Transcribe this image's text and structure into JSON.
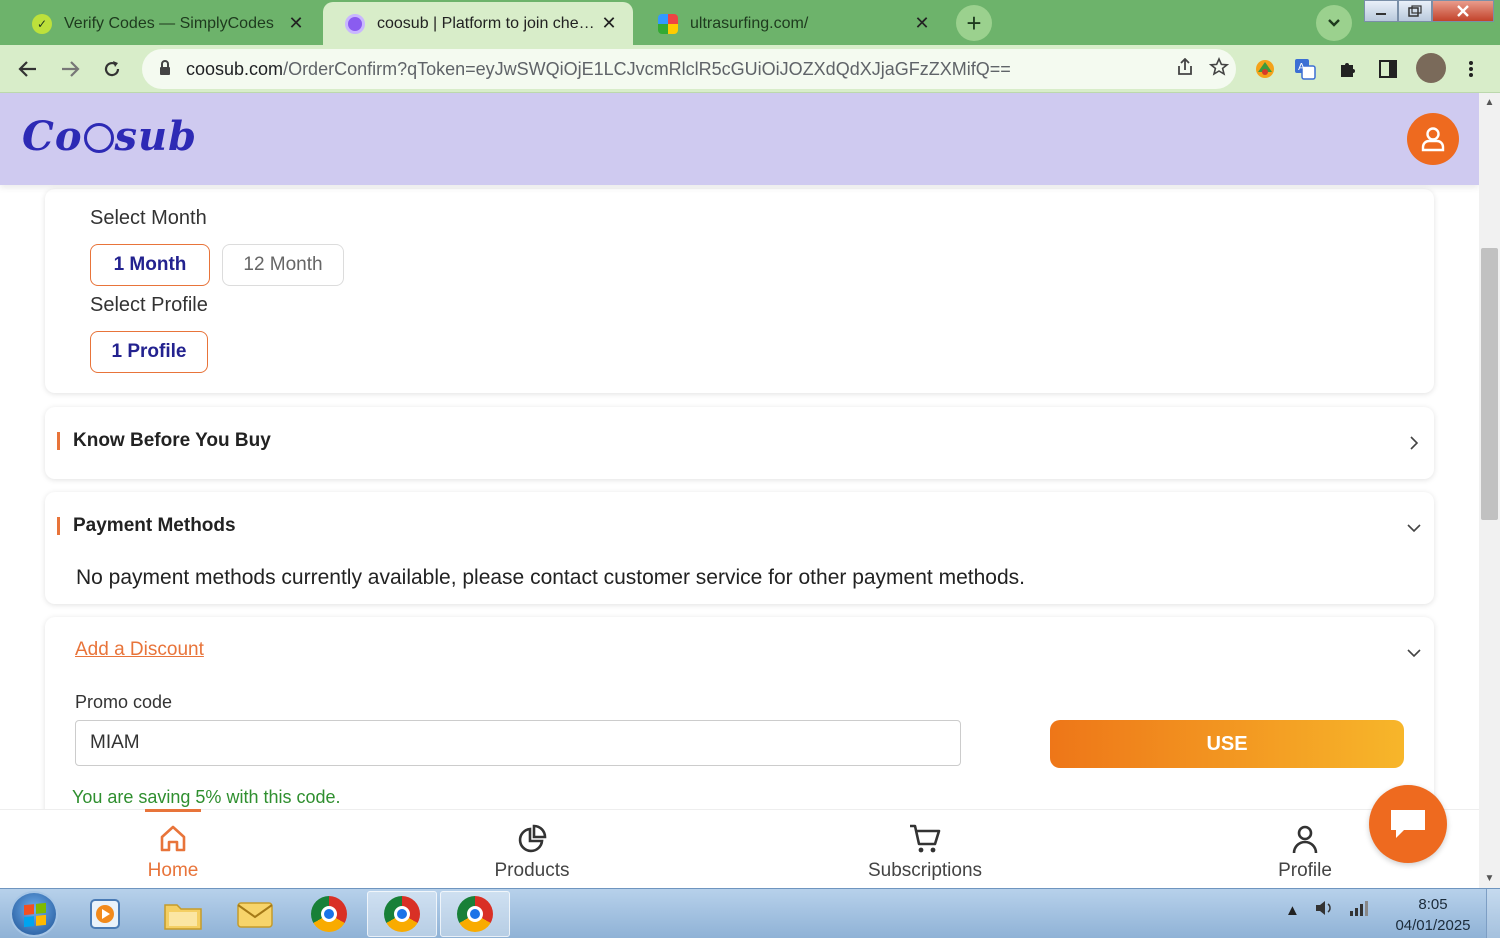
{
  "browser": {
    "tabs": [
      {
        "title": "Verify Codes — SimplyCodes",
        "close": "✕"
      },
      {
        "title": "coosub | Platform to join cheap s",
        "close": "✕"
      },
      {
        "title": "ultrasurfing.com/",
        "close": "✕"
      }
    ],
    "new_tab": "+",
    "url_host": "coosub.com",
    "url_path": "/OrderConfirm?qToken=eyJwSWQiOjE1LCJvcmRlclR5cGUiOiJOZXdQdXJjaGFzZXMifQ=="
  },
  "site": {
    "logo_left": "Co",
    "logo_right": "sub"
  },
  "order": {
    "month_label": "Select Month",
    "month_options": [
      "1 Month",
      "12 Month"
    ],
    "profile_label": "Select Profile",
    "profile_option": "1 Profile"
  },
  "sections": {
    "know_before": "Know Before You Buy",
    "payment_title": "Payment Methods",
    "payment_message": "No payment methods currently available, please contact customer service for other payment methods.",
    "discount_link": "Add a Discount",
    "promo_label": "Promo code",
    "promo_value": "MIAM",
    "use_button": "USE",
    "saving_message": "You are saving 5% with this code."
  },
  "bottom_nav": {
    "home": "Home",
    "products": "Products",
    "subscriptions": "Subscriptions",
    "profile": "Profile"
  },
  "taskbar": {
    "time": "8:05",
    "date": "04/01/2025"
  },
  "colors": {
    "accent": "#e8743a",
    "brand": "#2d2ab5",
    "header_bg": "#cfcaf0",
    "success": "#2f8f2f"
  }
}
